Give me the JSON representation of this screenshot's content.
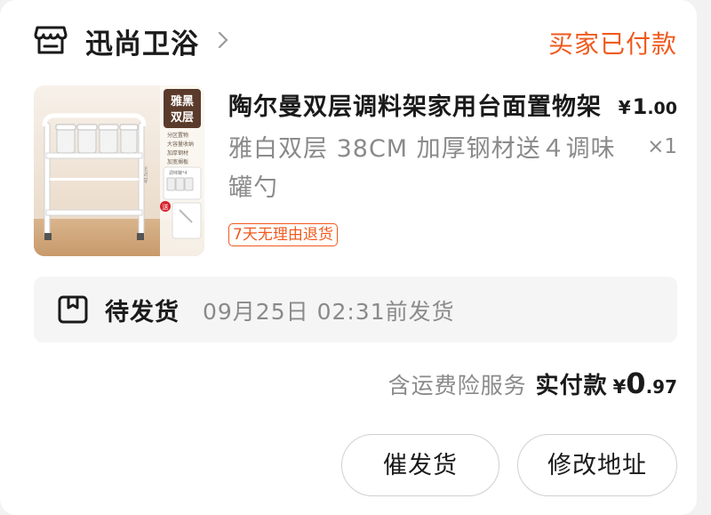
{
  "shop": {
    "name": "迅尚卫浴",
    "icon": "shop-icon",
    "chevron_icon": "chevron-right-icon"
  },
  "order": {
    "status": "买家已付款"
  },
  "product": {
    "title": "陶尔曼双层调料架家用台面置物架",
    "variant": "雅白双层 38CM 加厚钢材送４调味罐勺",
    "price_symbol": "¥",
    "price_int": "1",
    "price_dec": ".00",
    "quantity": "×1",
    "return_badge": "7天无理由退货",
    "thumbnail": {
      "corner_label_line1": "雅黑",
      "corner_label_line2": "双层",
      "features": [
        "分区置物",
        "大容量收纳",
        "加厚钢材",
        "加宽搁板"
      ],
      "bundle_label": "调味罐*4",
      "gift_tag": "送",
      "dimension_label": "40.5cm"
    }
  },
  "shipping": {
    "icon": "package-box-icon",
    "status": "待发货",
    "deadline": "09月25日 02:31前发货"
  },
  "payment": {
    "note": "含运费险服务",
    "label": "实付款",
    "amount_symbol": "¥",
    "amount_int": "0",
    "amount_dec": ".97"
  },
  "actions": {
    "urge_shipping": "催发货",
    "change_address": "修改地址"
  },
  "colors": {
    "accent": "#f05a1e",
    "text_primary": "#1a1a1a",
    "text_secondary": "#8a8a8a",
    "panel_bg": "#f5f5f5"
  }
}
